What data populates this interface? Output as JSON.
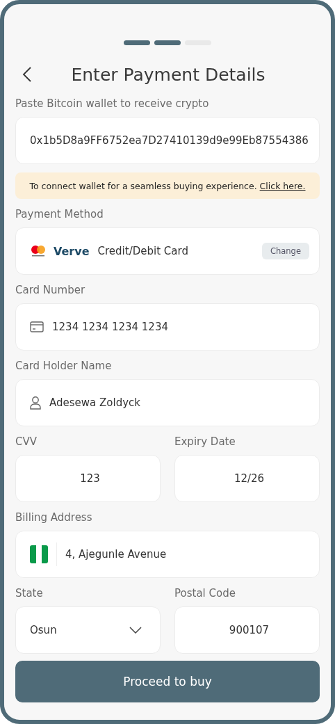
{
  "progress_steps": [
    {
      "active": true
    },
    {
      "active": true
    },
    {
      "active": false
    }
  ],
  "header": {
    "title": "Enter Payment Details"
  },
  "wallet": {
    "label": "Paste Bitcoin wallet to receive crypto",
    "value": "0x1b5D8a9FF6752ea7D27410139d9e99Eb87554386"
  },
  "notice": {
    "text": "To connect wallet for a seamless buying experience.",
    "link": "Click here."
  },
  "payment_method": {
    "label": "Payment Method",
    "logo_text": "Verve",
    "value": "Credit/Debit Card",
    "button": "Change"
  },
  "card_number": {
    "label": "Card Number",
    "value": "1234 1234 1234 1234"
  },
  "card_holder": {
    "label": "Card Holder Name",
    "value": "Adesewa Zoldyck"
  },
  "cvv": {
    "label": "CVV",
    "value": "123"
  },
  "expiry": {
    "label": "Expiry Date",
    "value": "12/26"
  },
  "billing_address": {
    "label": "Billing Address",
    "value": "4, Ajegunle Avenue"
  },
  "state": {
    "label": "State",
    "value": "Osun"
  },
  "postal_code": {
    "label": "Postal Code",
    "value": "900107"
  },
  "submit": {
    "label": "Proceed to buy"
  }
}
